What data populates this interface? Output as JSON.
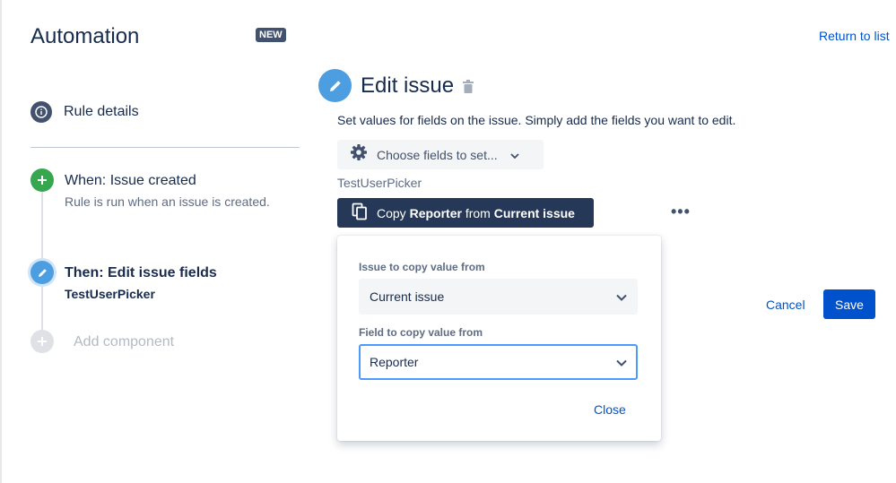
{
  "header": {
    "title": "Automation",
    "badge": "NEW",
    "return_link": "Return to list"
  },
  "sidebar": {
    "rule_details": "Rule details",
    "steps": [
      {
        "title": "When: Issue created",
        "subtitle": "Rule is run when an issue is created."
      },
      {
        "title": "Then: Edit issue fields",
        "subtitle": "TestUserPicker"
      }
    ],
    "add_component": "Add component"
  },
  "editor": {
    "title": "Edit issue",
    "description": "Set values for fields on the issue. Simply add the fields you want to edit.",
    "choose_fields": "Choose fields to set...",
    "field_label": "TestUserPicker",
    "copy_button": {
      "prefix": "Copy ",
      "field": "Reporter",
      "middle": " from ",
      "source": "Current issue"
    },
    "more": "•••",
    "cancel": "Cancel",
    "save": "Save"
  },
  "popup": {
    "issue_label": "Issue to copy value from",
    "issue_value": "Current issue",
    "field_label": "Field to copy value from",
    "field_value": "Reporter",
    "close": "Close"
  },
  "colors": {
    "accent": "#0052cc",
    "edit_blue": "#4c9ee0",
    "trigger_green": "#36a64f",
    "dark_button": "#253858"
  }
}
